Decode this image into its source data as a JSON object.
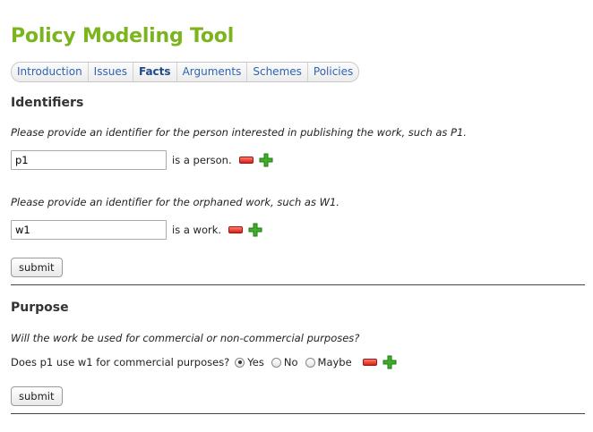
{
  "app": {
    "title": "Policy Modeling Tool"
  },
  "tabs": [
    {
      "label": "Introduction",
      "active": false
    },
    {
      "label": "Issues",
      "active": false
    },
    {
      "label": "Facts",
      "active": true
    },
    {
      "label": "Arguments",
      "active": false
    },
    {
      "label": "Schemes",
      "active": false
    },
    {
      "label": "Policies",
      "active": false
    }
  ],
  "identifiers": {
    "heading": "Identifiers",
    "person_prompt": "Please provide an identifier for the person interested in publishing the work, such as P1.",
    "person_value": "p1",
    "person_suffix": "is a person.",
    "work_prompt": "Please provide an identifier for the orphaned work, such as W1.",
    "work_value": "w1",
    "work_suffix": "is a work.",
    "submit_label": "submit"
  },
  "purpose": {
    "heading": "Purpose",
    "prompt": "Will the work be used for commercial or non-commercial purposes?",
    "question": "Does p1 use w1 for commercial purposes?",
    "options": [
      "Yes",
      "No",
      "Maybe"
    ],
    "selected": "Yes",
    "submit_label": "submit"
  },
  "colors": {
    "title": "#7ab51d",
    "tab_link": "#2f63b4",
    "minus": "#d61f14",
    "plus": "#3fae2a"
  },
  "icons": {
    "remove": "minus-icon",
    "add": "plus-icon"
  }
}
